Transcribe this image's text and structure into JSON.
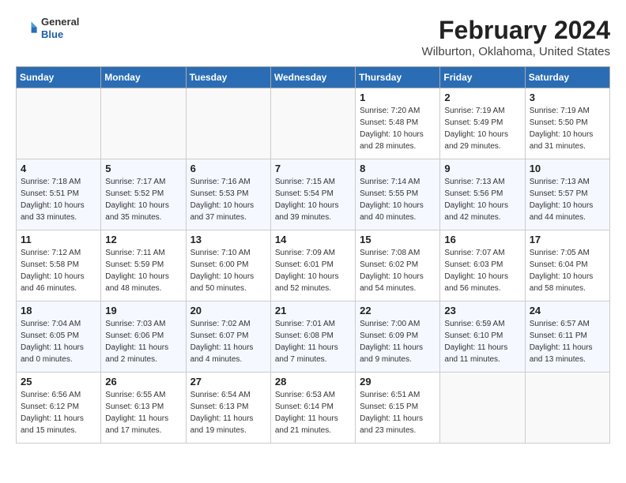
{
  "header": {
    "logo_general": "General",
    "logo_blue": "Blue",
    "month_title": "February 2024",
    "location": "Wilburton, Oklahoma, United States"
  },
  "weekdays": [
    "Sunday",
    "Monday",
    "Tuesday",
    "Wednesday",
    "Thursday",
    "Friday",
    "Saturday"
  ],
  "weeks": [
    [
      {
        "day": "",
        "info": ""
      },
      {
        "day": "",
        "info": ""
      },
      {
        "day": "",
        "info": ""
      },
      {
        "day": "",
        "info": ""
      },
      {
        "day": "1",
        "info": "Sunrise: 7:20 AM\nSunset: 5:48 PM\nDaylight: 10 hours\nand 28 minutes."
      },
      {
        "day": "2",
        "info": "Sunrise: 7:19 AM\nSunset: 5:49 PM\nDaylight: 10 hours\nand 29 minutes."
      },
      {
        "day": "3",
        "info": "Sunrise: 7:19 AM\nSunset: 5:50 PM\nDaylight: 10 hours\nand 31 minutes."
      }
    ],
    [
      {
        "day": "4",
        "info": "Sunrise: 7:18 AM\nSunset: 5:51 PM\nDaylight: 10 hours\nand 33 minutes."
      },
      {
        "day": "5",
        "info": "Sunrise: 7:17 AM\nSunset: 5:52 PM\nDaylight: 10 hours\nand 35 minutes."
      },
      {
        "day": "6",
        "info": "Sunrise: 7:16 AM\nSunset: 5:53 PM\nDaylight: 10 hours\nand 37 minutes."
      },
      {
        "day": "7",
        "info": "Sunrise: 7:15 AM\nSunset: 5:54 PM\nDaylight: 10 hours\nand 39 minutes."
      },
      {
        "day": "8",
        "info": "Sunrise: 7:14 AM\nSunset: 5:55 PM\nDaylight: 10 hours\nand 40 minutes."
      },
      {
        "day": "9",
        "info": "Sunrise: 7:13 AM\nSunset: 5:56 PM\nDaylight: 10 hours\nand 42 minutes."
      },
      {
        "day": "10",
        "info": "Sunrise: 7:13 AM\nSunset: 5:57 PM\nDaylight: 10 hours\nand 44 minutes."
      }
    ],
    [
      {
        "day": "11",
        "info": "Sunrise: 7:12 AM\nSunset: 5:58 PM\nDaylight: 10 hours\nand 46 minutes."
      },
      {
        "day": "12",
        "info": "Sunrise: 7:11 AM\nSunset: 5:59 PM\nDaylight: 10 hours\nand 48 minutes."
      },
      {
        "day": "13",
        "info": "Sunrise: 7:10 AM\nSunset: 6:00 PM\nDaylight: 10 hours\nand 50 minutes."
      },
      {
        "day": "14",
        "info": "Sunrise: 7:09 AM\nSunset: 6:01 PM\nDaylight: 10 hours\nand 52 minutes."
      },
      {
        "day": "15",
        "info": "Sunrise: 7:08 AM\nSunset: 6:02 PM\nDaylight: 10 hours\nand 54 minutes."
      },
      {
        "day": "16",
        "info": "Sunrise: 7:07 AM\nSunset: 6:03 PM\nDaylight: 10 hours\nand 56 minutes."
      },
      {
        "day": "17",
        "info": "Sunrise: 7:05 AM\nSunset: 6:04 PM\nDaylight: 10 hours\nand 58 minutes."
      }
    ],
    [
      {
        "day": "18",
        "info": "Sunrise: 7:04 AM\nSunset: 6:05 PM\nDaylight: 11 hours\nand 0 minutes."
      },
      {
        "day": "19",
        "info": "Sunrise: 7:03 AM\nSunset: 6:06 PM\nDaylight: 11 hours\nand 2 minutes."
      },
      {
        "day": "20",
        "info": "Sunrise: 7:02 AM\nSunset: 6:07 PM\nDaylight: 11 hours\nand 4 minutes."
      },
      {
        "day": "21",
        "info": "Sunrise: 7:01 AM\nSunset: 6:08 PM\nDaylight: 11 hours\nand 7 minutes."
      },
      {
        "day": "22",
        "info": "Sunrise: 7:00 AM\nSunset: 6:09 PM\nDaylight: 11 hours\nand 9 minutes."
      },
      {
        "day": "23",
        "info": "Sunrise: 6:59 AM\nSunset: 6:10 PM\nDaylight: 11 hours\nand 11 minutes."
      },
      {
        "day": "24",
        "info": "Sunrise: 6:57 AM\nSunset: 6:11 PM\nDaylight: 11 hours\nand 13 minutes."
      }
    ],
    [
      {
        "day": "25",
        "info": "Sunrise: 6:56 AM\nSunset: 6:12 PM\nDaylight: 11 hours\nand 15 minutes."
      },
      {
        "day": "26",
        "info": "Sunrise: 6:55 AM\nSunset: 6:13 PM\nDaylight: 11 hours\nand 17 minutes."
      },
      {
        "day": "27",
        "info": "Sunrise: 6:54 AM\nSunset: 6:13 PM\nDaylight: 11 hours\nand 19 minutes."
      },
      {
        "day": "28",
        "info": "Sunrise: 6:53 AM\nSunset: 6:14 PM\nDaylight: 11 hours\nand 21 minutes."
      },
      {
        "day": "29",
        "info": "Sunrise: 6:51 AM\nSunset: 6:15 PM\nDaylight: 11 hours\nand 23 minutes."
      },
      {
        "day": "",
        "info": ""
      },
      {
        "day": "",
        "info": ""
      }
    ]
  ]
}
